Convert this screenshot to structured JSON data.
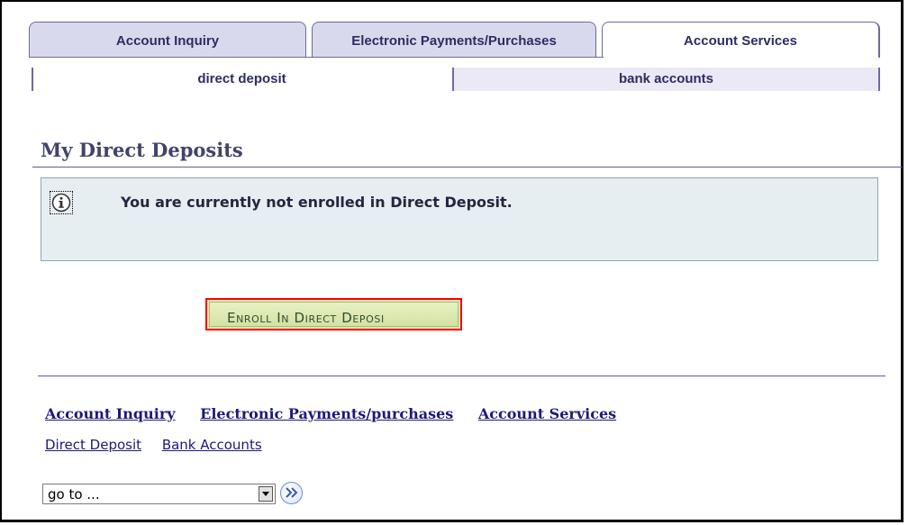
{
  "tabs": [
    {
      "label": "Account Inquiry",
      "active": false
    },
    {
      "label": "Electronic Payments/Purchases",
      "active": false
    },
    {
      "label": "Account Services",
      "active": true
    }
  ],
  "subtabs": [
    {
      "label": "direct deposit",
      "active": true
    },
    {
      "label": "bank accounts",
      "active": false
    }
  ],
  "page": {
    "title": "My Direct Deposits",
    "info_message": "You are currently not enrolled in Direct Deposit.",
    "enroll_button": "Enroll In Direct Deposi"
  },
  "footer": {
    "links": [
      "Account Inquiry",
      "Electronic Payments/purchases",
      "Account Services"
    ],
    "sublinks": [
      "Direct Deposit",
      "Bank Accounts"
    ],
    "goto_value": "go to ..."
  },
  "icons": {
    "info": "info-icon",
    "dropdown": "chevron-down-icon",
    "go": "double-chevron-right-icon"
  },
  "colors": {
    "tab_inactive_bg": "#d9d9ee",
    "title_text": "#42436b",
    "info_bg": "#e7eef2",
    "enroll_bg": "#d9e6b2",
    "enroll_highlight_border": "#ff0000",
    "link": "#1a1a7a"
  }
}
